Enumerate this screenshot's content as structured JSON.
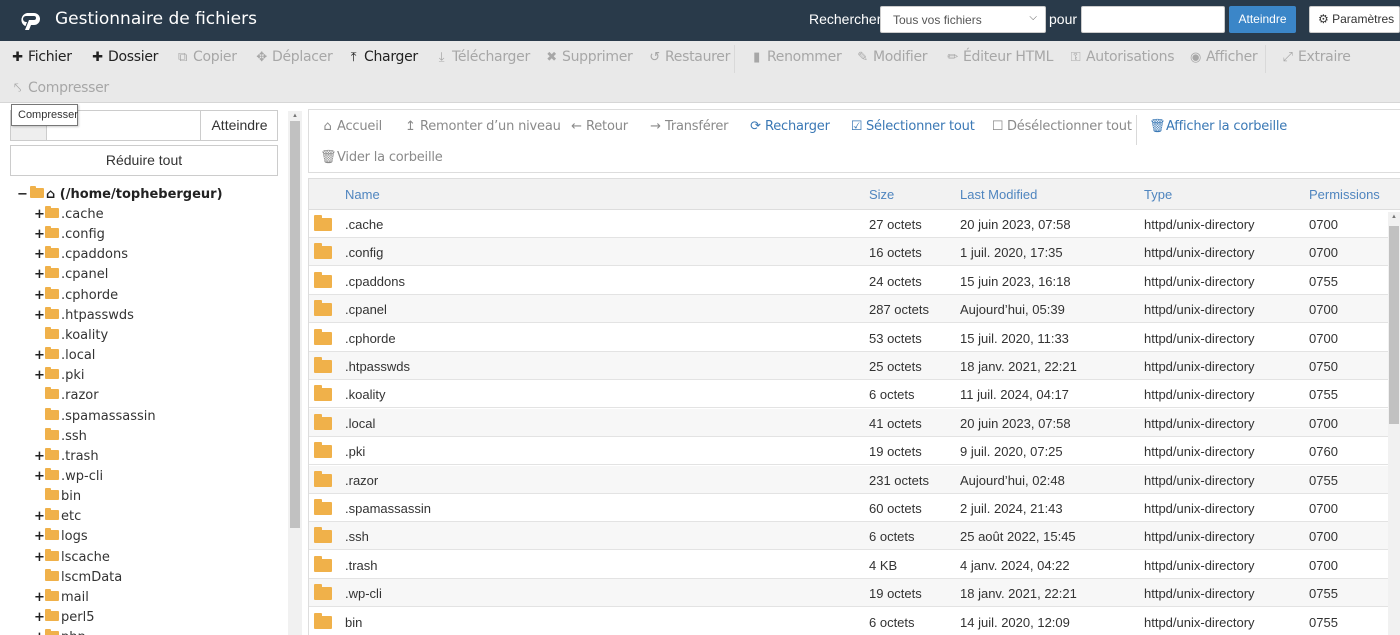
{
  "header": {
    "app_title": "Gestionnaire de fichiers",
    "logo": "cpanel-logo",
    "search_label": "Rechercher",
    "search_scope": "Tous vos fichiers",
    "for_label": "pour",
    "search_value": "",
    "go_label": "Atteindre",
    "settings_label": "Paramètres",
    "settings_icon": "gear-icon"
  },
  "toolbar": {
    "items": [
      {
        "label": "Fichier",
        "icon": "plus-icon",
        "enabled": true
      },
      {
        "label": "Dossier",
        "icon": "plus-icon",
        "enabled": true
      },
      {
        "label": "Copier",
        "icon": "copy-icon",
        "enabled": false
      },
      {
        "label": "Déplacer",
        "icon": "move-icon",
        "enabled": false
      },
      {
        "label": "Charger",
        "icon": "upload-icon",
        "enabled": true
      },
      {
        "label": "Télécharger",
        "icon": "download-icon",
        "enabled": false
      },
      {
        "label": "Supprimer",
        "icon": "close-icon",
        "enabled": false
      },
      {
        "label": "Restaurer",
        "icon": "undo-icon",
        "enabled": false
      },
      {
        "label": "Renommer",
        "icon": "file-icon",
        "enabled": false
      },
      {
        "label": "Modifier",
        "icon": "pencil-icon",
        "enabled": false
      },
      {
        "label": "Éditeur HTML",
        "icon": "edit-icon",
        "enabled": false
      },
      {
        "label": "Autorisations",
        "icon": "key-icon",
        "enabled": false
      },
      {
        "label": "Afficher",
        "icon": "eye-icon",
        "enabled": false
      },
      {
        "label": "Extraire",
        "icon": "expand-icon",
        "enabled": false
      },
      {
        "label": "Compresser",
        "icon": "compress-icon",
        "enabled": false
      }
    ],
    "tooltip": "Compresser"
  },
  "sidebar": {
    "path_value": "",
    "go_label": "Atteindre",
    "collapse_label": "Réduire tout",
    "root_label": "(/home/tophebergeur)",
    "tree": [
      {
        "name": ".cache",
        "expandable": true
      },
      {
        "name": ".config",
        "expandable": true
      },
      {
        "name": ".cpaddons",
        "expandable": true
      },
      {
        "name": ".cpanel",
        "expandable": true
      },
      {
        "name": ".cphorde",
        "expandable": true
      },
      {
        "name": ".htpasswds",
        "expandable": true
      },
      {
        "name": ".koality",
        "expandable": false
      },
      {
        "name": ".local",
        "expandable": true
      },
      {
        "name": ".pki",
        "expandable": true
      },
      {
        "name": ".razor",
        "expandable": false
      },
      {
        "name": ".spamassassin",
        "expandable": false
      },
      {
        "name": ".ssh",
        "expandable": false
      },
      {
        "name": ".trash",
        "expandable": true
      },
      {
        "name": ".wp-cli",
        "expandable": true
      },
      {
        "name": "bin",
        "expandable": false
      },
      {
        "name": "etc",
        "expandable": true
      },
      {
        "name": "logs",
        "expandable": true
      },
      {
        "name": "lscache",
        "expandable": true
      },
      {
        "name": "lscmData",
        "expandable": false
      },
      {
        "name": "mail",
        "expandable": true
      },
      {
        "name": "perl5",
        "expandable": true
      },
      {
        "name": "php",
        "expandable": true
      }
    ]
  },
  "navbar": {
    "items": [
      {
        "label": "Accueil",
        "icon": "home-icon",
        "style": "gray"
      },
      {
        "label": "Remonter d’un niveau",
        "icon": "level-up-icon",
        "style": "gray"
      },
      {
        "label": "Retour",
        "icon": "arrow-left-icon",
        "style": "gray"
      },
      {
        "label": "Transférer",
        "icon": "arrow-right-icon",
        "style": "gray"
      },
      {
        "label": "Recharger",
        "icon": "refresh-icon",
        "style": "blue"
      },
      {
        "label": "Sélectionner tout",
        "icon": "checkbox-checked-icon",
        "style": "blue"
      },
      {
        "label": "Désélectionner tout",
        "icon": "checkbox-empty-icon",
        "style": "gray"
      },
      {
        "label": "Afficher la corbeille",
        "icon": "trash-icon",
        "style": "blue"
      },
      {
        "label": "Vider la corbeille",
        "icon": "trash-icon",
        "style": "gray"
      }
    ]
  },
  "table": {
    "columns": [
      "Name",
      "Size",
      "Last Modified",
      "Type",
      "Permissions"
    ],
    "rows": [
      {
        "name": ".cache",
        "size": "27 octets",
        "modified": "20 juin 2023, 07:58",
        "type": "httpd/unix-directory",
        "perms": "0700"
      },
      {
        "name": ".config",
        "size": "16 octets",
        "modified": "1 juil. 2020, 17:35",
        "type": "httpd/unix-directory",
        "perms": "0700"
      },
      {
        "name": ".cpaddons",
        "size": "24 octets",
        "modified": "15 juin 2023, 16:18",
        "type": "httpd/unix-directory",
        "perms": "0755"
      },
      {
        "name": ".cpanel",
        "size": "287 octets",
        "modified": "Aujourd’hui, 05:39",
        "type": "httpd/unix-directory",
        "perms": "0700"
      },
      {
        "name": ".cphorde",
        "size": "53 octets",
        "modified": "15 juil. 2020, 11:33",
        "type": "httpd/unix-directory",
        "perms": "0700"
      },
      {
        "name": ".htpasswds",
        "size": "25 octets",
        "modified": "18 janv. 2021, 22:21",
        "type": "httpd/unix-directory",
        "perms": "0750"
      },
      {
        "name": ".koality",
        "size": "6 octets",
        "modified": "11 juil. 2024, 04:17",
        "type": "httpd/unix-directory",
        "perms": "0755"
      },
      {
        "name": ".local",
        "size": "41 octets",
        "modified": "20 juin 2023, 07:58",
        "type": "httpd/unix-directory",
        "perms": "0700"
      },
      {
        "name": ".pki",
        "size": "19 octets",
        "modified": "9 juil. 2020, 07:25",
        "type": "httpd/unix-directory",
        "perms": "0760"
      },
      {
        "name": ".razor",
        "size": "231 octets",
        "modified": "Aujourd’hui, 02:48",
        "type": "httpd/unix-directory",
        "perms": "0755"
      },
      {
        "name": ".spamassassin",
        "size": "60 octets",
        "modified": "2 juil. 2024, 21:43",
        "type": "httpd/unix-directory",
        "perms": "0700"
      },
      {
        "name": ".ssh",
        "size": "6 octets",
        "modified": "25 août 2022, 15:45",
        "type": "httpd/unix-directory",
        "perms": "0700"
      },
      {
        "name": ".trash",
        "size": "4 KB",
        "modified": "4 janv. 2024, 04:22",
        "type": "httpd/unix-directory",
        "perms": "0700"
      },
      {
        "name": ".wp-cli",
        "size": "19 octets",
        "modified": "18 janv. 2021, 22:21",
        "type": "httpd/unix-directory",
        "perms": "0755"
      },
      {
        "name": "bin",
        "size": "6 octets",
        "modified": "14 juil. 2020, 12:09",
        "type": "httpd/unix-directory",
        "perms": "0755"
      }
    ]
  },
  "colors": {
    "header_bg": "#293a4a",
    "accent_blue": "#3b86c8",
    "link_blue": "#3a78b5",
    "folder": "#f0b14a"
  }
}
